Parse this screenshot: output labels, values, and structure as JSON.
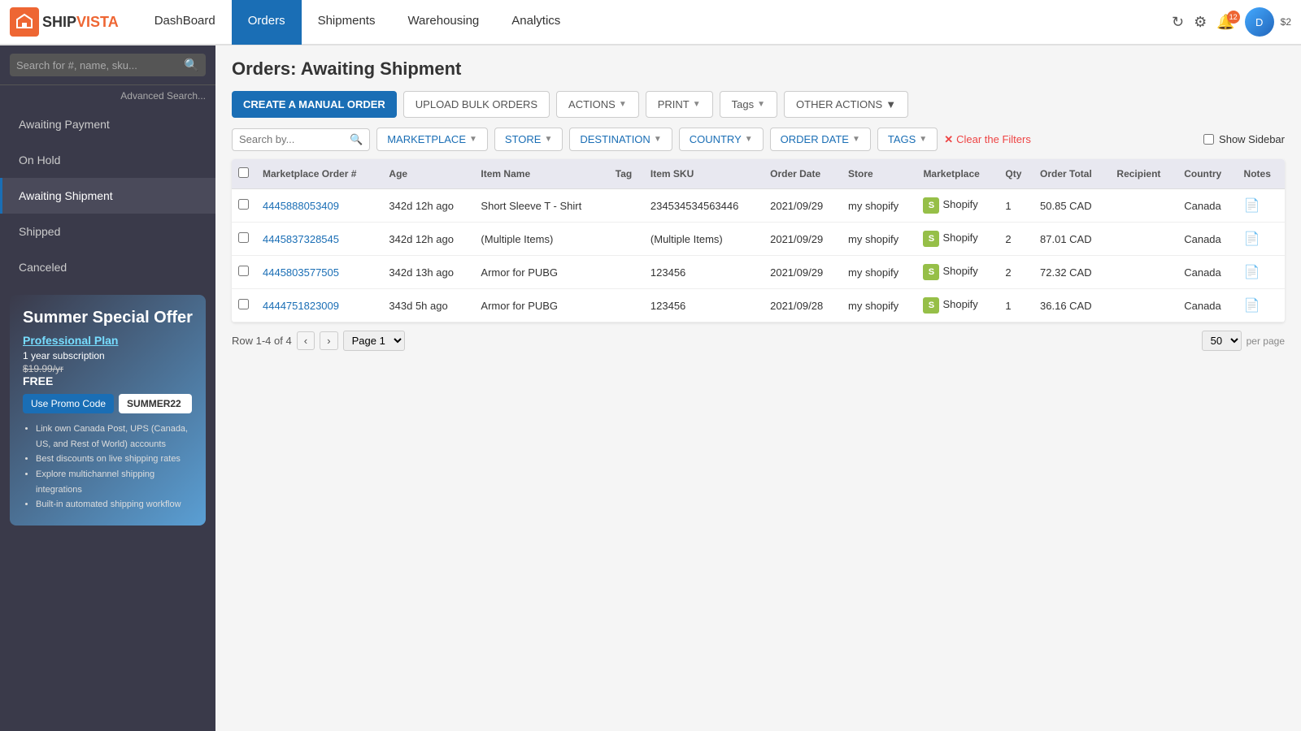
{
  "app": {
    "logo_text_ship": "SHIP",
    "logo_text_vista": "VISTA"
  },
  "topnav": {
    "items": [
      {
        "label": "DashBoard",
        "active": false
      },
      {
        "label": "Orders",
        "active": true
      },
      {
        "label": "Shipments",
        "active": false
      },
      {
        "label": "Warehousing",
        "active": false
      },
      {
        "label": "Analytics",
        "active": false
      }
    ],
    "notification_count": "12",
    "user_initials": "D",
    "user_balance": "$2"
  },
  "sidebar": {
    "search_placeholder": "Search for #, name, sku...",
    "advanced_search_label": "Advanced Search...",
    "nav_items": [
      {
        "label": "Awaiting Payment",
        "active": false
      },
      {
        "label": "On Hold",
        "active": false
      },
      {
        "label": "Awaiting Shipment",
        "active": true
      },
      {
        "label": "Shipped",
        "active": false
      },
      {
        "label": "Canceled",
        "active": false
      }
    ],
    "promo": {
      "title": "Summer Special Offer",
      "plan_label": "Professional Plan",
      "subscription": "1 year subscription",
      "old_price": "$19.99/yr",
      "free_label": "FREE",
      "use_promo_label": "Use Promo Code",
      "promo_code": "SUMMER22",
      "bullets": [
        "Link own Canada Post, UPS (Canada, US, and Rest of World) accounts",
        "Best discounts on live shipping rates",
        "Explore multichannel shipping integrations",
        "Built-in automated shipping workflow"
      ]
    }
  },
  "page": {
    "title": "Orders: Awaiting Shipment"
  },
  "actions": {
    "create_manual": "CREATE A MANUAL ORDER",
    "upload_bulk": "UPLOAD BULK ORDERS",
    "actions_label": "ACTIONS",
    "print_label": "PRINT",
    "tags_label": "Tags",
    "other_actions_label": "OTHER ACTIONS"
  },
  "filters": {
    "search_placeholder": "Search by...",
    "marketplace_label": "MARKETPLACE",
    "store_label": "STORE",
    "destination_label": "DESTINATION",
    "country_label": "COUNTRY",
    "order_date_label": "ORDER DATE",
    "tags_label": "TAGS",
    "clear_filters_label": "Clear the Filters",
    "show_sidebar_label": "Show Sidebar"
  },
  "table": {
    "columns": [
      "Marketplace Order #",
      "Age",
      "Item Name",
      "Tag",
      "Item SKU",
      "Order Date",
      "Store",
      "Marketplace",
      "Qty",
      "Order Total",
      "Recipient",
      "Country",
      "Notes"
    ],
    "rows": [
      {
        "order_num": "4445888053409",
        "age": "342d 12h ago",
        "item_name": "Short Sleeve T - Shirt",
        "tag": "",
        "item_sku": "234534534563446",
        "order_date": "2021/09/29",
        "store": "my shopify",
        "marketplace": "Shopify",
        "qty": "1",
        "order_total": "50.85 CAD",
        "recipient": "",
        "country": "Canada",
        "notes": "📄"
      },
      {
        "order_num": "4445837328545",
        "age": "342d 12h ago",
        "item_name": "(Multiple Items)",
        "tag": "",
        "item_sku": "(Multiple Items)",
        "order_date": "2021/09/29",
        "store": "my shopify",
        "marketplace": "Shopify",
        "qty": "2",
        "order_total": "87.01 CAD",
        "recipient": "",
        "country": "Canada",
        "notes": "📄"
      },
      {
        "order_num": "4445803577505",
        "age": "342d 13h ago",
        "item_name": "Armor for PUBG",
        "tag": "",
        "item_sku": "123456",
        "order_date": "2021/09/29",
        "store": "my shopify",
        "marketplace": "Shopify",
        "qty": "2",
        "order_total": "72.32 CAD",
        "recipient": "",
        "country": "Canada",
        "notes": "📄"
      },
      {
        "order_num": "4444751823009",
        "age": "343d 5h ago",
        "item_name": "Armor for PUBG",
        "tag": "",
        "item_sku": "123456",
        "order_date": "2021/09/28",
        "store": "my shopify",
        "marketplace": "Shopify",
        "qty": "1",
        "order_total": "36.16 CAD",
        "recipient": "",
        "country": "Canada",
        "notes": "📄"
      }
    ]
  },
  "pagination": {
    "row_info": "Row 1-4 of 4",
    "page_label": "Page 1",
    "per_page_value": "50",
    "per_page_label": "per page"
  }
}
